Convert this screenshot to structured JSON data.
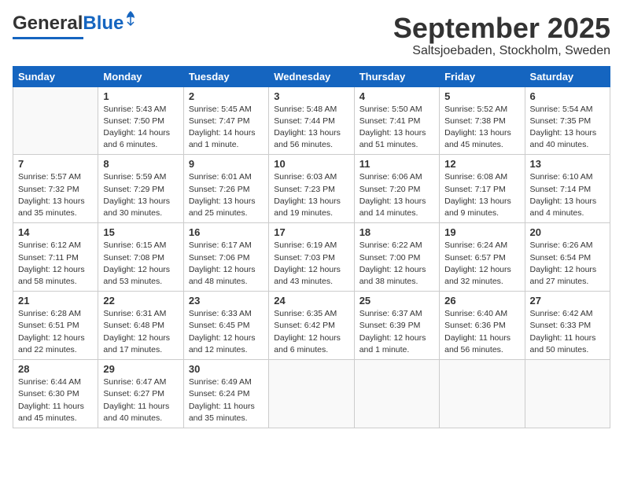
{
  "header": {
    "logo_general": "General",
    "logo_blue": "Blue",
    "month": "September 2025",
    "location": "Saltsjoebaden, Stockholm, Sweden"
  },
  "days_of_week": [
    "Sunday",
    "Monday",
    "Tuesday",
    "Wednesday",
    "Thursday",
    "Friday",
    "Saturday"
  ],
  "weeks": [
    [
      {
        "day": "",
        "sunrise": "",
        "sunset": "",
        "daylight": ""
      },
      {
        "day": "1",
        "sunrise": "Sunrise: 5:43 AM",
        "sunset": "Sunset: 7:50 PM",
        "daylight": "Daylight: 14 hours and 6 minutes."
      },
      {
        "day": "2",
        "sunrise": "Sunrise: 5:45 AM",
        "sunset": "Sunset: 7:47 PM",
        "daylight": "Daylight: 14 hours and 1 minute."
      },
      {
        "day": "3",
        "sunrise": "Sunrise: 5:48 AM",
        "sunset": "Sunset: 7:44 PM",
        "daylight": "Daylight: 13 hours and 56 minutes."
      },
      {
        "day": "4",
        "sunrise": "Sunrise: 5:50 AM",
        "sunset": "Sunset: 7:41 PM",
        "daylight": "Daylight: 13 hours and 51 minutes."
      },
      {
        "day": "5",
        "sunrise": "Sunrise: 5:52 AM",
        "sunset": "Sunset: 7:38 PM",
        "daylight": "Daylight: 13 hours and 45 minutes."
      },
      {
        "day": "6",
        "sunrise": "Sunrise: 5:54 AM",
        "sunset": "Sunset: 7:35 PM",
        "daylight": "Daylight: 13 hours and 40 minutes."
      }
    ],
    [
      {
        "day": "7",
        "sunrise": "Sunrise: 5:57 AM",
        "sunset": "Sunset: 7:32 PM",
        "daylight": "Daylight: 13 hours and 35 minutes."
      },
      {
        "day": "8",
        "sunrise": "Sunrise: 5:59 AM",
        "sunset": "Sunset: 7:29 PM",
        "daylight": "Daylight: 13 hours and 30 minutes."
      },
      {
        "day": "9",
        "sunrise": "Sunrise: 6:01 AM",
        "sunset": "Sunset: 7:26 PM",
        "daylight": "Daylight: 13 hours and 25 minutes."
      },
      {
        "day": "10",
        "sunrise": "Sunrise: 6:03 AM",
        "sunset": "Sunset: 7:23 PM",
        "daylight": "Daylight: 13 hours and 19 minutes."
      },
      {
        "day": "11",
        "sunrise": "Sunrise: 6:06 AM",
        "sunset": "Sunset: 7:20 PM",
        "daylight": "Daylight: 13 hours and 14 minutes."
      },
      {
        "day": "12",
        "sunrise": "Sunrise: 6:08 AM",
        "sunset": "Sunset: 7:17 PM",
        "daylight": "Daylight: 13 hours and 9 minutes."
      },
      {
        "day": "13",
        "sunrise": "Sunrise: 6:10 AM",
        "sunset": "Sunset: 7:14 PM",
        "daylight": "Daylight: 13 hours and 4 minutes."
      }
    ],
    [
      {
        "day": "14",
        "sunrise": "Sunrise: 6:12 AM",
        "sunset": "Sunset: 7:11 PM",
        "daylight": "Daylight: 12 hours and 58 minutes."
      },
      {
        "day": "15",
        "sunrise": "Sunrise: 6:15 AM",
        "sunset": "Sunset: 7:08 PM",
        "daylight": "Daylight: 12 hours and 53 minutes."
      },
      {
        "day": "16",
        "sunrise": "Sunrise: 6:17 AM",
        "sunset": "Sunset: 7:06 PM",
        "daylight": "Daylight: 12 hours and 48 minutes."
      },
      {
        "day": "17",
        "sunrise": "Sunrise: 6:19 AM",
        "sunset": "Sunset: 7:03 PM",
        "daylight": "Daylight: 12 hours and 43 minutes."
      },
      {
        "day": "18",
        "sunrise": "Sunrise: 6:22 AM",
        "sunset": "Sunset: 7:00 PM",
        "daylight": "Daylight: 12 hours and 38 minutes."
      },
      {
        "day": "19",
        "sunrise": "Sunrise: 6:24 AM",
        "sunset": "Sunset: 6:57 PM",
        "daylight": "Daylight: 12 hours and 32 minutes."
      },
      {
        "day": "20",
        "sunrise": "Sunrise: 6:26 AM",
        "sunset": "Sunset: 6:54 PM",
        "daylight": "Daylight: 12 hours and 27 minutes."
      }
    ],
    [
      {
        "day": "21",
        "sunrise": "Sunrise: 6:28 AM",
        "sunset": "Sunset: 6:51 PM",
        "daylight": "Daylight: 12 hours and 22 minutes."
      },
      {
        "day": "22",
        "sunrise": "Sunrise: 6:31 AM",
        "sunset": "Sunset: 6:48 PM",
        "daylight": "Daylight: 12 hours and 17 minutes."
      },
      {
        "day": "23",
        "sunrise": "Sunrise: 6:33 AM",
        "sunset": "Sunset: 6:45 PM",
        "daylight": "Daylight: 12 hours and 12 minutes."
      },
      {
        "day": "24",
        "sunrise": "Sunrise: 6:35 AM",
        "sunset": "Sunset: 6:42 PM",
        "daylight": "Daylight: 12 hours and 6 minutes."
      },
      {
        "day": "25",
        "sunrise": "Sunrise: 6:37 AM",
        "sunset": "Sunset: 6:39 PM",
        "daylight": "Daylight: 12 hours and 1 minute."
      },
      {
        "day": "26",
        "sunrise": "Sunrise: 6:40 AM",
        "sunset": "Sunset: 6:36 PM",
        "daylight": "Daylight: 11 hours and 56 minutes."
      },
      {
        "day": "27",
        "sunrise": "Sunrise: 6:42 AM",
        "sunset": "Sunset: 6:33 PM",
        "daylight": "Daylight: 11 hours and 50 minutes."
      }
    ],
    [
      {
        "day": "28",
        "sunrise": "Sunrise: 6:44 AM",
        "sunset": "Sunset: 6:30 PM",
        "daylight": "Daylight: 11 hours and 45 minutes."
      },
      {
        "day": "29",
        "sunrise": "Sunrise: 6:47 AM",
        "sunset": "Sunset: 6:27 PM",
        "daylight": "Daylight: 11 hours and 40 minutes."
      },
      {
        "day": "30",
        "sunrise": "Sunrise: 6:49 AM",
        "sunset": "Sunset: 6:24 PM",
        "daylight": "Daylight: 11 hours and 35 minutes."
      },
      {
        "day": "",
        "sunrise": "",
        "sunset": "",
        "daylight": ""
      },
      {
        "day": "",
        "sunrise": "",
        "sunset": "",
        "daylight": ""
      },
      {
        "day": "",
        "sunrise": "",
        "sunset": "",
        "daylight": ""
      },
      {
        "day": "",
        "sunrise": "",
        "sunset": "",
        "daylight": ""
      }
    ]
  ]
}
